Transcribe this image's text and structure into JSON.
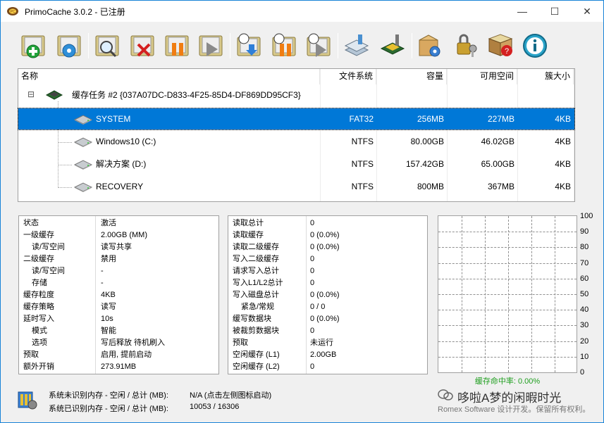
{
  "window": {
    "title": "PrimoCache 3.0.2 - 已注册",
    "minimize_icon": "minimize-icon",
    "maximize_icon": "maximize-icon",
    "close_icon": "close-icon"
  },
  "toolbar": {
    "buttons": [
      {
        "icon": "new-cache-task-icon"
      },
      {
        "icon": "cache-settings-icon"
      },
      {
        "icon": "statistics-icon"
      },
      {
        "icon": "delete-task-icon"
      },
      {
        "icon": "pause-task-icon"
      },
      {
        "icon": "resume-task-icon"
      },
      {
        "icon": "load-cache-icon"
      },
      {
        "icon": "pause-all-icon"
      },
      {
        "icon": "resume-all-icon"
      },
      {
        "icon": "drives-icon"
      },
      {
        "icon": "chip-tools-icon"
      },
      {
        "icon": "package-settings-icon"
      },
      {
        "icon": "keys-icon"
      },
      {
        "icon": "help-book-icon"
      },
      {
        "icon": "info-icon"
      }
    ]
  },
  "tree": {
    "headers": {
      "name": "名称",
      "fs": "文件系统",
      "capacity": "容量",
      "free": "可用空间",
      "cluster": "簇大小"
    },
    "task": {
      "collapse": "⊟",
      "label": "缓存任务 #2 {037A07DC-D833-4F25-85D4-DF869DD95CF3}"
    },
    "drives": [
      {
        "name": "SYSTEM",
        "fs": "FAT32",
        "capacity": "256MB",
        "free": "227MB",
        "cluster": "4KB"
      },
      {
        "name": "Windows10 (C:)",
        "fs": "NTFS",
        "capacity": "80.00GB",
        "free": "46.02GB",
        "cluster": "4KB"
      },
      {
        "name": "解决方案 (D:)",
        "fs": "NTFS",
        "capacity": "157.42GB",
        "free": "65.00GB",
        "cluster": "4KB"
      },
      {
        "name": "RECOVERY",
        "fs": "NTFS",
        "capacity": "800MB",
        "free": "367MB",
        "cluster": "4KB"
      }
    ]
  },
  "left_panel": [
    {
      "k": "状态",
      "v": "激活"
    },
    {
      "k": "一级缓存",
      "v": "2.00GB (MM)"
    },
    {
      "k": "读/写空间",
      "v": "读写共享"
    },
    {
      "k": "二级缓存",
      "v": "禁用"
    },
    {
      "k": "读/写空间",
      "v": "-"
    },
    {
      "k": "存储",
      "v": "-"
    },
    {
      "k": "缓存粒度",
      "v": "4KB"
    },
    {
      "k": "缓存策略",
      "v": "读写"
    },
    {
      "k": "延时写入",
      "v": "10s"
    },
    {
      "k": "模式",
      "v": "智能"
    },
    {
      "k": "选项",
      "v": "写后释放 待机刷入"
    },
    {
      "k": "预取",
      "v": "启用, 提前启动"
    },
    {
      "k": "额外开销",
      "v": "273.91MB"
    }
  ],
  "mid_panel": [
    {
      "k": "读取总计",
      "v": "0"
    },
    {
      "k": "读取缓存",
      "v": "0 (0.0%)"
    },
    {
      "k": "读取二级缓存",
      "v": "0 (0.0%)"
    },
    {
      "k": "写入二级缓存",
      "v": "0"
    },
    {
      "k": "请求写入总计",
      "v": "0"
    },
    {
      "k": "写入L1/L2总计",
      "v": "0"
    },
    {
      "k": "写入磁盘总计",
      "v": "0 (0.0%)"
    },
    {
      "k": "紧急/常规",
      "v": "0 / 0"
    },
    {
      "k": "缓写数据块",
      "v": "0 (0.0%)"
    },
    {
      "k": "被裁剪数据块",
      "v": "0"
    },
    {
      "k": "预取",
      "v": "未运行"
    },
    {
      "k": "空闲缓存 (L1)",
      "v": "2.00GB"
    },
    {
      "k": "空闲缓存 (L2)",
      "v": "0"
    }
  ],
  "graph": {
    "y_ticks": [
      "100",
      "90",
      "80",
      "70",
      "60",
      "50",
      "40",
      "30",
      "20",
      "10",
      "0"
    ],
    "hit_rate_label": "缓存命中率: 0.00%",
    "hit_rate_value": 0.0
  },
  "status": {
    "unrecognized_label": "系统未识别内存 - 空闲 / 总计 (MB):",
    "unrecognized_value": "N/A (点击左侧图标启动)",
    "recognized_label": "系统已识别内存 - 空闲 / 总计 (MB):",
    "recognized_value": "10053 / 16306"
  },
  "footer": {
    "copyright": "Romex Software 设计开发。保留所有权利。",
    "watermark": "哆啦A梦的闲暇时光"
  }
}
